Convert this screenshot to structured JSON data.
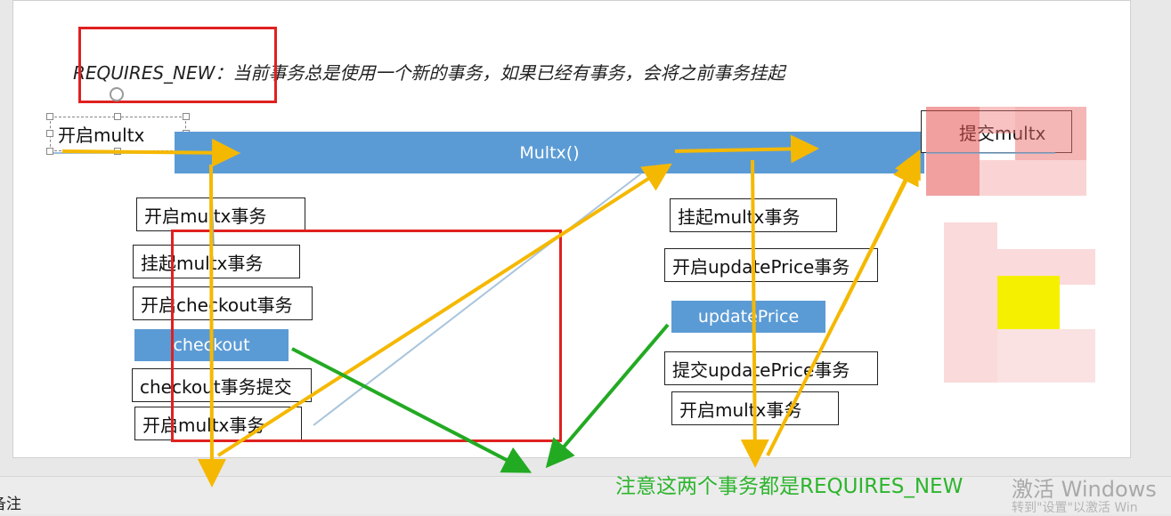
{
  "heading": "REQUIRES_NEW：当前事务总是使用一个新的事务，如果已经有事务，会将之前事务挂起",
  "start_box": "开启multx",
  "main_bar": "Multx()",
  "commit_box": "提交multx",
  "left_steps": {
    "open_tx": "开启multx事务",
    "suspend": "挂起multx事务",
    "open_checkout": "开启checkout事务",
    "checkout": "checkout",
    "checkout_commit": "checkout事务提交",
    "reopen": "开启multx事务"
  },
  "right_steps": {
    "suspend": "挂起multx事务",
    "open_update": "开启updatePrice事务",
    "update": "updatePrice",
    "update_commit": "提交updatePrice事务",
    "reopen": "开启multx事务"
  },
  "note_text": "注意这两个事务都是REQUIRES_NEW",
  "bottom_notes": "备注",
  "watermark": {
    "line1": "激活 Windows",
    "line2": "转到\"设置\"以激活 Win"
  },
  "colors": {
    "arrow_orange": "#f5b800",
    "arrow_green": "#22aa22",
    "red": "#e02020",
    "blue": "#5b9bd5"
  }
}
